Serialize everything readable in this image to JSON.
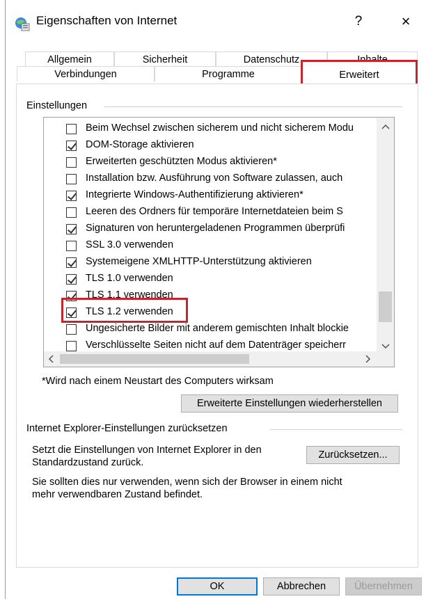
{
  "window": {
    "title": "Eigenschaften von Internet",
    "help_label": "?",
    "close_label": "×"
  },
  "tabs": {
    "row1": [
      "Allgemein",
      "Sicherheit",
      "Datenschutz",
      "Inhalte"
    ],
    "row2": [
      "Verbindungen",
      "Programme",
      "Erweitert"
    ],
    "active": "Erweitert"
  },
  "settings": {
    "group_label": "Einstellungen",
    "items": [
      {
        "label": "Beim Wechsel zwischen sicherem und nicht sicherem Modu",
        "checked": false
      },
      {
        "label": "DOM-Storage aktivieren",
        "checked": true
      },
      {
        "label": "Erweiterten geschützten Modus aktivieren*",
        "checked": false
      },
      {
        "label": "Installation bzw. Ausführung von Software zulassen, auch",
        "checked": false
      },
      {
        "label": "Integrierte Windows-Authentifizierung aktivieren*",
        "checked": true
      },
      {
        "label": "Leeren des Ordners für temporäre Internetdateien beim S",
        "checked": false
      },
      {
        "label": "Signaturen von heruntergeladenen Programmen überprüfi",
        "checked": true
      },
      {
        "label": "SSL 3.0 verwenden",
        "checked": false
      },
      {
        "label": "Systemeigene XMLHTTP-Unterstützung aktivieren",
        "checked": true
      },
      {
        "label": "TLS 1.0 verwenden",
        "checked": true
      },
      {
        "label": "TLS 1.1 verwenden",
        "checked": true
      },
      {
        "label": "TLS 1.2 verwenden",
        "checked": true
      },
      {
        "label": "Ungesicherte Bilder mit anderem gemischten Inhalt blockie",
        "checked": false
      },
      {
        "label": "Verschlüsselte Seiten nicht auf dem Datenträger speicherr",
        "checked": false
      }
    ],
    "restart_note": "*Wird nach einem Neustart des Computers wirksam",
    "restore_button": "Erweiterte Einstellungen wiederherstellen"
  },
  "reset": {
    "group_label": "Internet Explorer-Einstellungen zurücksetzen",
    "text1_line1": "Setzt die Einstellungen von Internet Explorer in den",
    "text1_line2": "Standardzustand zurück.",
    "reset_button": "Zurücksetzen...",
    "text2_line1": "Sie sollten dies nur verwenden, wenn sich der Browser in einem nicht",
    "text2_line2": "mehr verwendbaren Zustand befindet."
  },
  "footer": {
    "ok": "OK",
    "cancel": "Abbrechen",
    "apply": "Übernehmen"
  },
  "colors": {
    "highlight": "#c1272d",
    "default_button_border": "#0078d7"
  }
}
